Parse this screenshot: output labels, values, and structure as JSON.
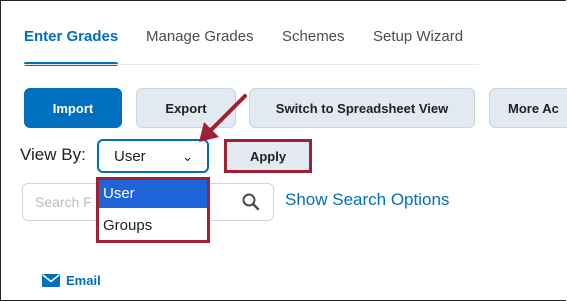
{
  "tabs": [
    {
      "label": "Enter Grades",
      "active": true
    },
    {
      "label": "Manage Grades"
    },
    {
      "label": "Schemes"
    },
    {
      "label": "Setup Wizard"
    }
  ],
  "toolbar": {
    "import": "Import",
    "export": "Export",
    "spreadsheet": "Switch to Spreadsheet View",
    "more": "More Ac"
  },
  "viewby": {
    "label": "View By:",
    "selected": "User",
    "options": [
      "User",
      "Groups"
    ],
    "apply": "Apply"
  },
  "search": {
    "placeholder": "Search F",
    "show_options": "Show Search Options"
  },
  "email": "Email",
  "colors": {
    "accent": "#006fbf",
    "highlight": "#9d2235",
    "option_selected": "#1e63d8"
  }
}
